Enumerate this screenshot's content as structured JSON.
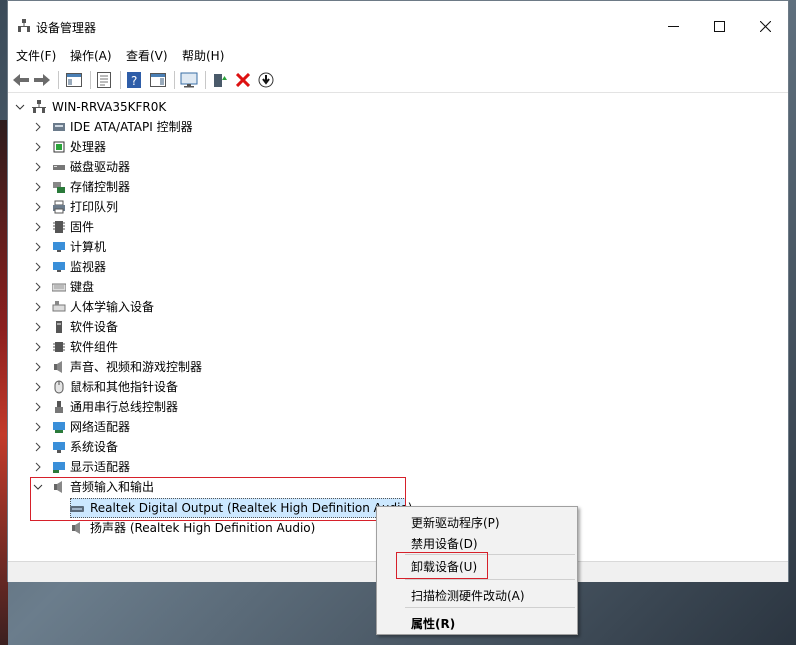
{
  "window": {
    "title": "设备管理器"
  },
  "menu": [
    "文件(F)",
    "操作(A)",
    "查看(V)",
    "帮助(H)"
  ],
  "tree": {
    "root": "WIN-RRVA35KFR0K",
    "categories": [
      {
        "label": "IDE ATA/ATAPI 控制器",
        "icon": "ide-controller-icon"
      },
      {
        "label": "处理器",
        "icon": "processor-icon"
      },
      {
        "label": "磁盘驱动器",
        "icon": "disk-drive-icon"
      },
      {
        "label": "存储控制器",
        "icon": "storage-controller-icon"
      },
      {
        "label": "打印队列",
        "icon": "printer-icon"
      },
      {
        "label": "固件",
        "icon": "firmware-icon"
      },
      {
        "label": "计算机",
        "icon": "computer-icon"
      },
      {
        "label": "监视器",
        "icon": "monitor-icon"
      },
      {
        "label": "键盘",
        "icon": "keyboard-icon"
      },
      {
        "label": "人体学输入设备",
        "icon": "hid-icon"
      },
      {
        "label": "软件设备",
        "icon": "software-device-icon"
      },
      {
        "label": "软件组件",
        "icon": "software-component-icon"
      },
      {
        "label": "声音、视频和游戏控制器",
        "icon": "speaker-icon"
      },
      {
        "label": "鼠标和其他指针设备",
        "icon": "mouse-icon"
      },
      {
        "label": "通用串行总线控制器",
        "icon": "usb-icon"
      },
      {
        "label": "网络适配器",
        "icon": "network-adapter-icon"
      },
      {
        "label": "系统设备",
        "icon": "system-device-icon"
      },
      {
        "label": "显示适配器",
        "icon": "display-adapter-icon"
      }
    ],
    "expanded": {
      "label": "音频输入和输出",
      "children": [
        "Realtek Digital Output (Realtek High Definition Audio)",
        "扬声器 (Realtek High Definition Audio)"
      ]
    }
  },
  "context_menu": {
    "items": [
      "更新驱动程序(P)",
      "禁用设备(D)",
      "卸载设备(U)",
      "扫描检测硬件改动(A)",
      "属性(R)"
    ]
  },
  "colors": {
    "highlight_box": "#d6202a",
    "selection": "#cce8ff"
  }
}
